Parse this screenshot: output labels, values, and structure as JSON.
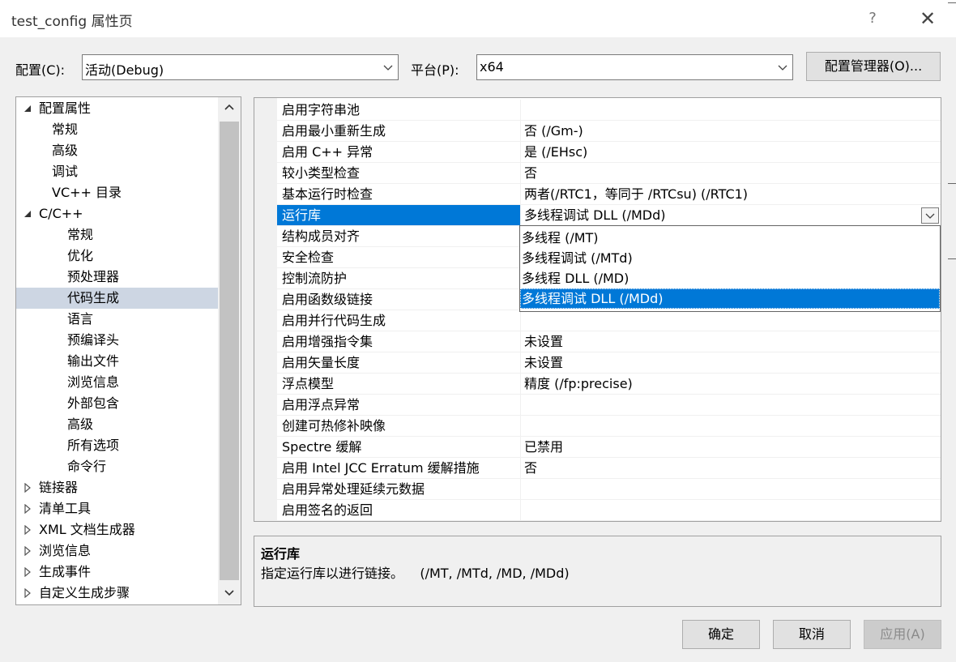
{
  "window": {
    "title": "test_config 属性页",
    "help_label": "?",
    "close_label": "✕"
  },
  "toolbar": {
    "config_label": "配置(C):",
    "config_value": "活动(Debug)",
    "platform_label": "平台(P):",
    "platform_value": "x64",
    "config_manager_label": "配置管理器(O)..."
  },
  "tree": {
    "items": [
      {
        "label": "配置属性",
        "expander": "open"
      },
      {
        "label": "常规"
      },
      {
        "label": "高级"
      },
      {
        "label": "调试"
      },
      {
        "label": "VC++ 目录"
      },
      {
        "label": "C/C++",
        "expander": "open"
      },
      {
        "label": "常规"
      },
      {
        "label": "优化"
      },
      {
        "label": "预处理器"
      },
      {
        "label": "代码生成",
        "selected": true
      },
      {
        "label": "语言"
      },
      {
        "label": "预编译头"
      },
      {
        "label": "输出文件"
      },
      {
        "label": "浏览信息"
      },
      {
        "label": "外部包含"
      },
      {
        "label": "高级"
      },
      {
        "label": "所有选项"
      },
      {
        "label": "命令行"
      },
      {
        "label": "链接器",
        "expander": "closed"
      },
      {
        "label": "清单工具",
        "expander": "closed"
      },
      {
        "label": "XML 文档生成器",
        "expander": "closed"
      },
      {
        "label": "浏览信息",
        "expander": "closed"
      },
      {
        "label": "生成事件",
        "expander": "closed"
      },
      {
        "label": "自定义生成步骤",
        "expander": "closed"
      }
    ]
  },
  "properties": [
    {
      "name": "启用字符串池",
      "value": ""
    },
    {
      "name": "启用最小重新生成",
      "value": "否 (/Gm-)"
    },
    {
      "name": "启用 C++ 异常",
      "value": "是 (/EHsc)"
    },
    {
      "name": "较小类型检查",
      "value": "否"
    },
    {
      "name": "基本运行时检查",
      "value": "两者(/RTC1，等同于 /RTCsu) (/RTC1)"
    },
    {
      "name": "运行库",
      "value": "多线程调试 DLL (/MDd)",
      "selected": true
    },
    {
      "name": "结构成员对齐",
      "value": ""
    },
    {
      "name": "安全检查",
      "value": ""
    },
    {
      "name": "控制流防护",
      "value": ""
    },
    {
      "name": "启用函数级链接",
      "value": ""
    },
    {
      "name": "启用并行代码生成",
      "value": ""
    },
    {
      "name": "启用增强指令集",
      "value": "未设置"
    },
    {
      "name": "启用矢量长度",
      "value": "未设置"
    },
    {
      "name": "浮点模型",
      "value": "精度 (/fp:precise)"
    },
    {
      "name": "启用浮点异常",
      "value": ""
    },
    {
      "name": "创建可热修补映像",
      "value": ""
    },
    {
      "name": "Spectre 缓解",
      "value": "已禁用"
    },
    {
      "name": "启用 Intel JCC Erratum 缓解措施",
      "value": "否"
    },
    {
      "name": "启用异常处理延续元数据",
      "value": ""
    },
    {
      "name": "启用签名的返回",
      "value": ""
    }
  ],
  "dropdown": {
    "options": [
      {
        "label": "多线程 (/MT)"
      },
      {
        "label": "多线程调试 (/MTd)"
      },
      {
        "label": "多线程 DLL (/MD)"
      },
      {
        "label": "多线程调试 DLL (/MDd)",
        "selected": true
      }
    ]
  },
  "description": {
    "title": "运行库",
    "text": "指定运行库以进行链接。    (/MT, /MTd, /MD, /MDd)"
  },
  "buttons": {
    "ok": "确定",
    "cancel": "取消",
    "apply": "应用(A)"
  },
  "colors": {
    "selection": "#0078d7",
    "tree_selection": "#cdd6e3"
  }
}
